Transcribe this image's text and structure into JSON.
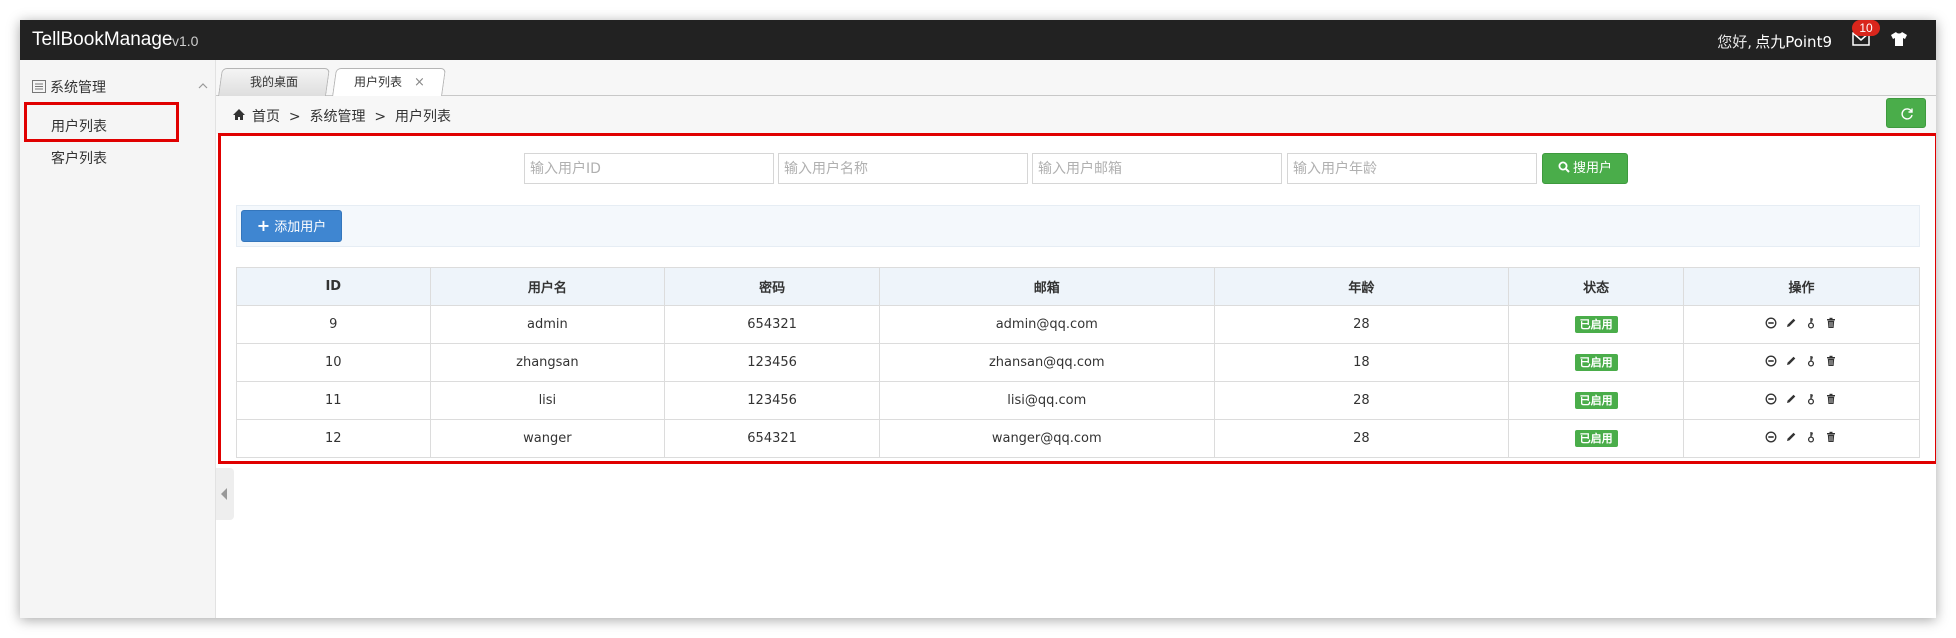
{
  "app": {
    "brand": "TellBookManage",
    "version": "v1.0",
    "greeting": "您好,",
    "username": "点九Point9",
    "notification_count": "10"
  },
  "sidebar": {
    "group_label": "系统管理",
    "items": [
      {
        "label": "用户列表",
        "selected": true
      },
      {
        "label": "客户列表",
        "selected": false
      }
    ]
  },
  "tabs": [
    {
      "label": "我的桌面",
      "active": false
    },
    {
      "label": "用户列表",
      "active": true,
      "close": "×"
    }
  ],
  "breadcrumb": "首页  >  系统管理  >  用户列表",
  "search": {
    "user_id_placeholder": "输入用户ID",
    "user_name_placeholder": "输入用户名称",
    "user_email_placeholder": "输入用户邮箱",
    "user_age_placeholder": "输入用户年龄",
    "button_label": "搜用户"
  },
  "toolbar": {
    "add_label": "添加用户"
  },
  "table": {
    "headers": [
      "ID",
      "用户名",
      "密码",
      "邮箱",
      "年龄",
      "状态",
      "操作"
    ],
    "rows": [
      {
        "id": "9",
        "name": "admin",
        "password": "654321",
        "email": "admin@qq.com",
        "age": "28",
        "status": "已启用"
      },
      {
        "id": "10",
        "name": "zhangsan",
        "password": "123456",
        "email": "zhansan@qq.com",
        "age": "18",
        "status": "已启用"
      },
      {
        "id": "11",
        "name": "lisi",
        "password": "123456",
        "email": "lisi@qq.com",
        "age": "28",
        "status": "已启用"
      },
      {
        "id": "12",
        "name": "wanger",
        "password": "654321",
        "email": "wanger@qq.com",
        "age": "28",
        "status": "已启用"
      }
    ],
    "row_actions": [
      "disable-icon",
      "edit-icon",
      "key-icon",
      "trash-icon"
    ]
  },
  "colors": {
    "topbar": "#222222",
    "success": "#4aad4a",
    "primary": "#3f86d1",
    "highlight": "#e00000"
  }
}
